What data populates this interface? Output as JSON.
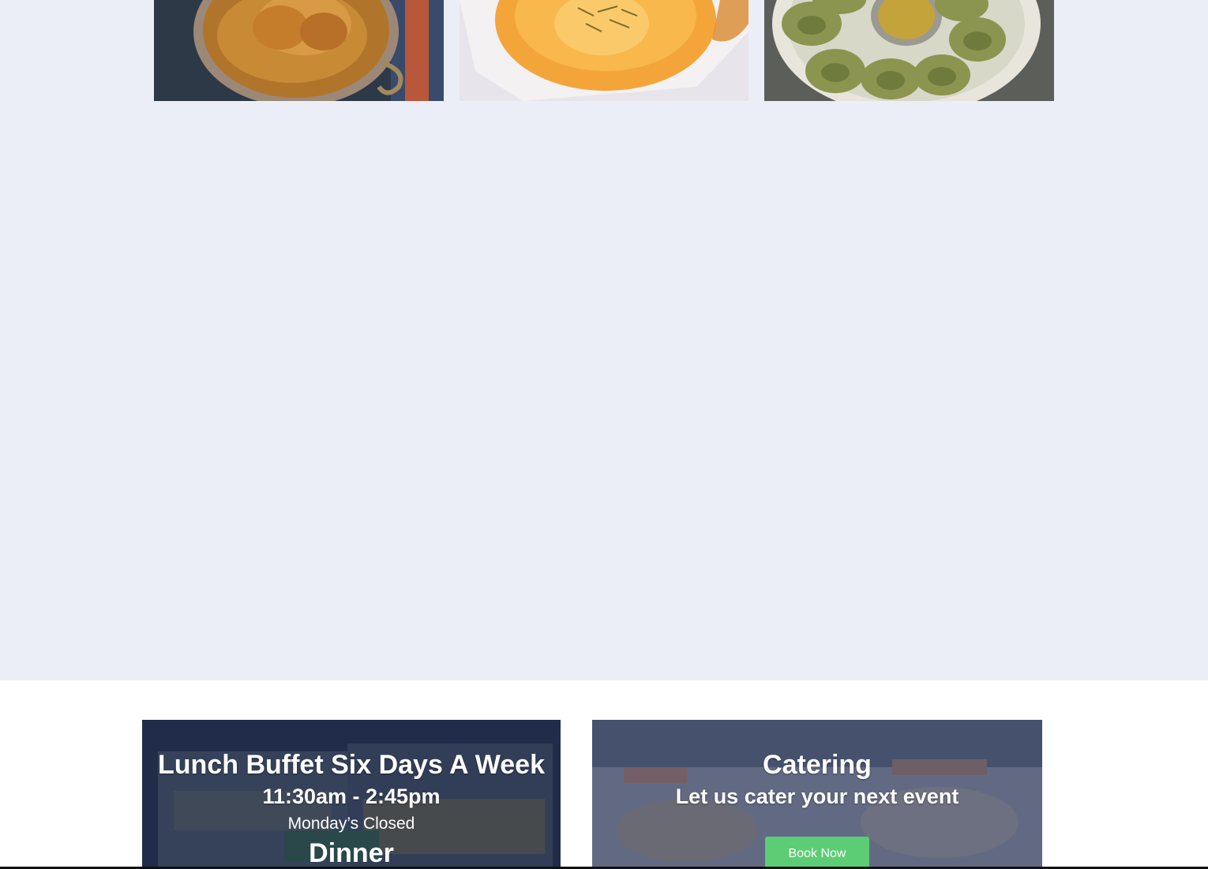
{
  "gallery": {
    "background": "#eceef7",
    "images": [
      {
        "subject": "curry dish in copper bowl"
      },
      {
        "subject": "dessert with saffron and pistachio in white bowl"
      },
      {
        "subject": "plate of momo dumplings with sauce"
      }
    ]
  },
  "lunch": {
    "title": "Lunch Buffet Six Days A Week",
    "hours": "11:30am - 2:45pm",
    "closed_note": "Monday’s Closed",
    "dinner_label": "Dinner"
  },
  "catering": {
    "title": "Catering",
    "subtitle": "Let us cater your next event",
    "button_label": "Book Now"
  },
  "colors": {
    "button": "#5ccd74",
    "overlay": "#1c2a4a"
  }
}
